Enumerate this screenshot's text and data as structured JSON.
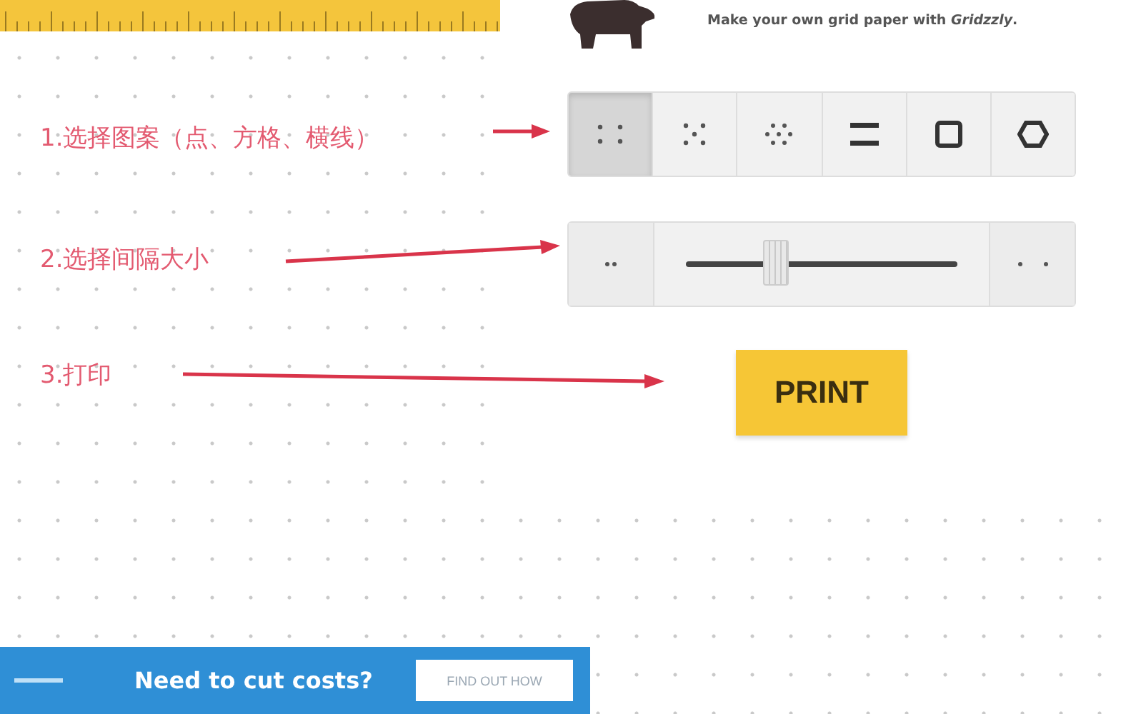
{
  "annotations": [
    {
      "text": "1.选择图案（点、方格、横线）"
    },
    {
      "text": "2.选择间隔大小"
    },
    {
      "text": "3.打印"
    }
  ],
  "tagline": "Make your own grid paper with *Gridzzly*.",
  "patterns": [
    {
      "kind": "dots",
      "selected": true
    },
    {
      "kind": "triangle-dots",
      "selected": false
    },
    {
      "kind": "dense-dots",
      "selected": false
    },
    {
      "kind": "lines",
      "selected": false
    },
    {
      "kind": "squares",
      "selected": false
    },
    {
      "kind": "hexagons",
      "selected": false
    }
  ],
  "spacing": {
    "level": 0.33
  },
  "print_button": "PRINT",
  "ad": {
    "headline": "Need to cut costs?",
    "button": "FIND OUT HOW"
  }
}
